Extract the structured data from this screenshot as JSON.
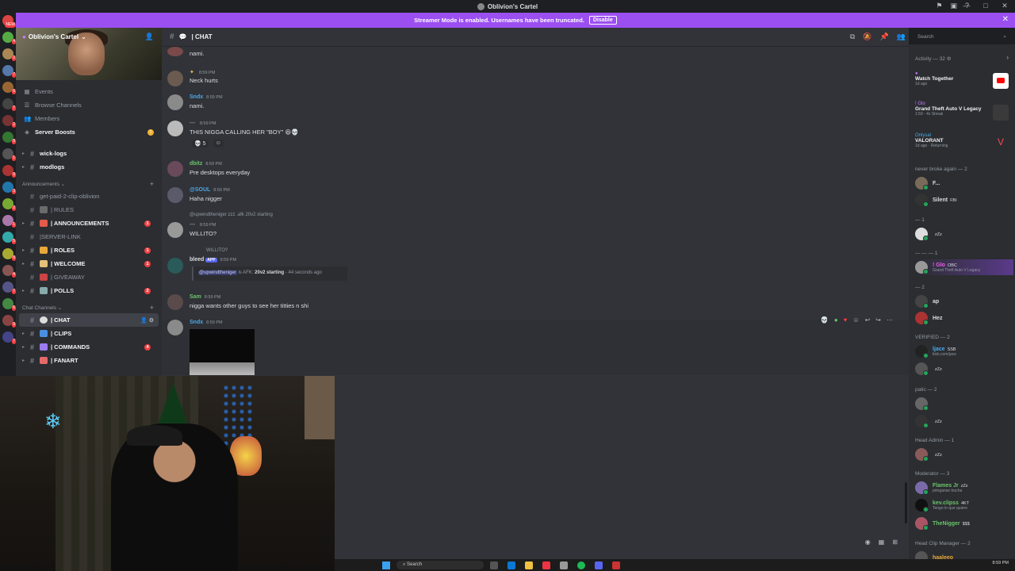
{
  "window": {
    "title": "Oblivion's Cartel"
  },
  "banner": {
    "text": "Streamer Mode is enabled. Usernames have been truncated.",
    "disable_label": "Disable",
    "close": "✕"
  },
  "server": {
    "name": "Oblivion's Cartel"
  },
  "nav": [
    {
      "label": "Events",
      "icon": "calendar-icon"
    },
    {
      "label": "Browse Channels",
      "icon": "browse-icon"
    },
    {
      "label": "Members",
      "icon": "members-icon"
    },
    {
      "label": "Server Boosts",
      "icon": "boost-icon"
    }
  ],
  "channels_top": [
    "wick-logs",
    "modlogs"
  ],
  "announcements_category": "Announcements",
  "announcements_channels": [
    {
      "label": "get-paid-2-clip-oblivion",
      "unread": false,
      "badge": ""
    },
    {
      "label": "| RULES",
      "unread": false,
      "badge": ""
    },
    {
      "label": "| ANNOUNCEMENTS",
      "unread": true,
      "badge": "1"
    },
    {
      "label": "|SERVER-LINK",
      "unread": false,
      "badge": ""
    },
    {
      "label": "| ROLES",
      "unread": true,
      "badge": "1"
    },
    {
      "label": "| WELCOME",
      "unread": true,
      "badge": "1"
    },
    {
      "label": "| GIVEAWAY",
      "unread": false,
      "badge": ""
    },
    {
      "label": "| POLLS",
      "unread": true,
      "badge": "2"
    }
  ],
  "chat_category": "Chat Channels",
  "chat_channels": [
    {
      "label": "| CHAT",
      "active": true,
      "badge": ""
    },
    {
      "label": "| CLIPS",
      "active": false,
      "badge": ""
    },
    {
      "label": "| COMMANDS",
      "active": false,
      "badge": "4"
    },
    {
      "label": "| FANART",
      "active": false,
      "badge": ""
    }
  ],
  "chat": {
    "channel_name": "| CHAT",
    "messages": [
      {
        "text": "nami."
      },
      {
        "time": "8:59 PM",
        "text": "Neck hurts"
      },
      {
        "user": "Sndx",
        "time": "8:59 PM",
        "text": "nami."
      },
      {
        "time": "8:59 PM",
        "text": "THIS NIGGA CALLING HER \"BOY\" 😆💀",
        "reactions": [
          "💀 5",
          "☺"
        ]
      },
      {
        "user": "dbitz",
        "time": "8:59 PM",
        "text": "Pre desktops everyday"
      },
      {
        "user": "@SOUL",
        "time": "8:59 PM",
        "text": "Haha nigger"
      },
      {
        "reply": "@upwindtheniger  zzz  .afk 20v2 starting",
        "time": "8:59 PM",
        "text": "WILLITO?"
      },
      {
        "reply": "WILLITO?",
        "user": "bleed",
        "app": "APP",
        "time": "8:59 PM",
        "embed_mention": "@upwindtheniger",
        "embed_text": " is AFK: ",
        "embed_bold": "20v2 starting",
        "embed_tail": " - 44 seconds ago"
      },
      {
        "user": "Sam",
        "time": "8:59 PM",
        "text": "nigga wants other guys to see her titties n shi"
      },
      {
        "user": "Sndx",
        "time": "8:59 PM"
      }
    ]
  },
  "search": {
    "placeholder": "Search"
  },
  "members": {
    "activity_title": "Activity — 32",
    "activities": [
      {
        "title": "Watch Together",
        "meta": "1d ago"
      },
      {
        "user": "! Glo",
        "title": "Grand Theft Auto V Legacy",
        "meta": "1:59 · 4x Streak"
      },
      {
        "user": "Onlysal",
        "title": "VALORANT",
        "meta": "1d ago · Returning"
      }
    ],
    "groups": [
      {
        "label": "never broke again — 2",
        "members": [
          {
            "name": "F...",
            "tag": ""
          },
          {
            "name": "Silent",
            "tag": "FBI"
          }
        ]
      },
      {
        "label": "— 1",
        "members": [
          {
            "name": "",
            "tag": "zZz"
          }
        ]
      },
      {
        "label": "— — — 1",
        "members": [
          {
            "name": "! Glo",
            "tag": "OBC",
            "sub": "Grand Theft Auto V Legacy"
          }
        ]
      },
      {
        "label": "— 2",
        "members": [
          {
            "name": "ap",
            "tag": ""
          },
          {
            "name": "Hez",
            "tag": ""
          }
        ]
      },
      {
        "label": "VERIFIED — 2",
        "members": [
          {
            "name": "ljace",
            "tag": "SSB",
            "sub": "kick.com/jace"
          },
          {
            "name": "",
            "tag": "zZz"
          }
        ]
      },
      {
        "label": "patic — 2",
        "members": [
          {
            "name": "",
            "tag": ""
          },
          {
            "name": "",
            "tag": "zZz"
          }
        ]
      },
      {
        "label": "Head Admin — 1",
        "members": [
          {
            "name": "",
            "tag": "zZz"
          }
        ]
      },
      {
        "label": "Moderator — 3",
        "members": [
          {
            "name": "Flames Jr",
            "tag": "zZz",
            "sub": "pónganse trucha"
          },
          {
            "name": "kev.clipss",
            "tag": "4KT",
            "sub": "Tengo lo que quiero"
          },
          {
            "name": "TheNigger",
            "tag": "$$$"
          }
        ]
      },
      {
        "label": "Head Clip Manager — 2",
        "members": [
          {
            "name": "haaleeo",
            "tag": ""
          }
        ]
      }
    ]
  },
  "taskbar": {
    "search": "Search",
    "time": "8:59 PM"
  },
  "colors": {
    "accent": "#9b4ff0",
    "bg": "#313338",
    "sidebar": "#2b2d31",
    "mention_badge": "#f23f42"
  }
}
